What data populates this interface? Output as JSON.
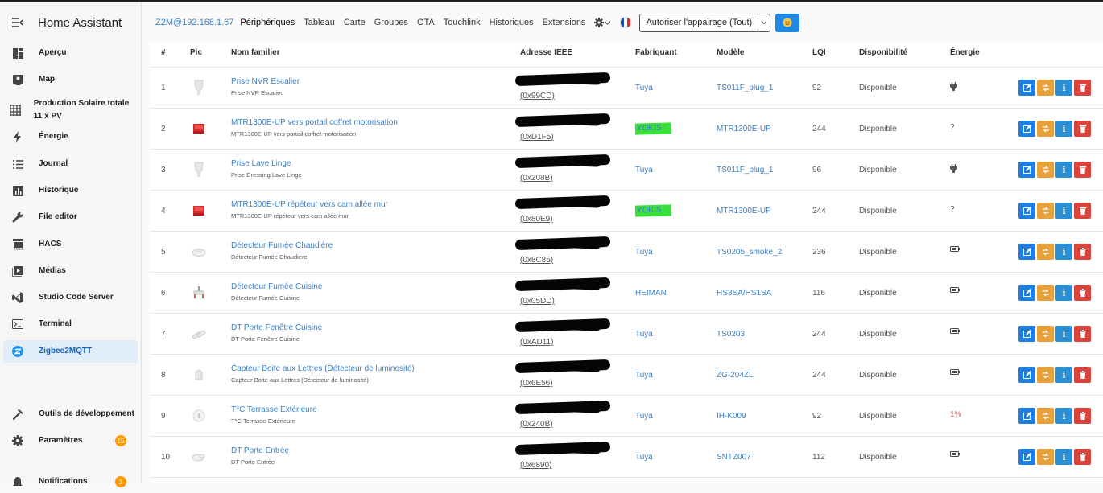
{
  "sidebar": {
    "title": "Home Assistant",
    "items": [
      {
        "label": "Aperçu",
        "icon": "dashboard-icon"
      },
      {
        "label": "Map",
        "icon": "map-icon"
      },
      {
        "label": "Production Solaire totale 11 x PV",
        "icon": "solar-grid-icon"
      },
      {
        "label": "Énergie",
        "icon": "lightning-icon"
      },
      {
        "label": "Journal",
        "icon": "list-icon"
      },
      {
        "label": "Historique",
        "icon": "chart-icon"
      },
      {
        "label": "File editor",
        "icon": "wrench-icon"
      },
      {
        "label": "HACS",
        "icon": "hacs-icon"
      },
      {
        "label": "Médias",
        "icon": "media-icon"
      },
      {
        "label": "Studio Code Server",
        "icon": "vscode-icon"
      },
      {
        "label": "Terminal",
        "icon": "terminal-icon"
      },
      {
        "label": "Zigbee2MQTT",
        "icon": "zigbee-icon"
      }
    ],
    "dev_tools": "Outils de développement",
    "settings": "Paramètres",
    "settings_badge": "15",
    "notifications": "Notifications",
    "notifications_badge": "3"
  },
  "nav": {
    "brand": "Z2M@192.168.1.67",
    "links": [
      "Périphériques",
      "Tableau",
      "Carte",
      "Groupes",
      "OTA",
      "Touchlink",
      "Historiques",
      "Extensions"
    ],
    "pairing_label": "Autoriser l'appairage (Tout)"
  },
  "table": {
    "headers": {
      "num": "#",
      "pic": "Pic",
      "name": "Nom familier",
      "ieee": "Adresse IEEE",
      "manufacturer": "Fabriquant",
      "model": "Modèle",
      "lqi": "LQI",
      "availability": "Disponibilité",
      "energy": "Énergie"
    },
    "rows": [
      {
        "num": "1",
        "name": "Prise NVR Escalier",
        "sub": "Prise NVR Escalier",
        "ieee": "(0x99CD)",
        "manufacturer": "Tuya",
        "model": "TS011F_plug_1",
        "lqi": "92",
        "availability": "Disponible",
        "energy": "plug",
        "pic": "plug"
      },
      {
        "num": "2",
        "name": "MTR1300E-UP vers portail coffret motorisation",
        "sub": "MTR1300E-UP vers portail coffret motorisation",
        "ieee": "(0xD1F5)",
        "manufacturer": "YOKIS",
        "model": "MTR1300E-UP",
        "lqi": "244",
        "availability": "Disponible",
        "energy": "?",
        "pic": "module"
      },
      {
        "num": "3",
        "name": "Prise Lave Linge",
        "sub": "Prise Dressing Lave Linge",
        "ieee": "(0x208B)",
        "manufacturer": "Tuya",
        "model": "TS011F_plug_1",
        "lqi": "96",
        "availability": "Disponible",
        "energy": "plug",
        "pic": "plug"
      },
      {
        "num": "4",
        "name": "MTR1300E-UP répéteur vers cam allée mur",
        "sub": "MTR1300E-UP répéteur vers cam allée mur",
        "ieee": "(0x80E9)",
        "manufacturer": "YOKIS",
        "model": "MTR1300E-UP",
        "lqi": "244",
        "availability": "Disponible",
        "energy": "?",
        "pic": "module"
      },
      {
        "num": "5",
        "name": "Détecteur Fumée Chaudière",
        "sub": "Détecteur Fumée Chaudière",
        "ieee": "(0x8C85)",
        "manufacturer": "Tuya",
        "model": "TS0205_smoke_2",
        "lqi": "236",
        "availability": "Disponible",
        "energy": "battery",
        "pic": "smoke"
      },
      {
        "num": "6",
        "name": "Détecteur Fumée Cuisine",
        "sub": "Détecteur Fumée Cuisine",
        "ieee": "(0x05DD)",
        "manufacturer": "HEIMAN",
        "model": "HS3SA/HS1SA",
        "lqi": "116",
        "availability": "Disponible",
        "energy": "battery",
        "pic": "smoke2"
      },
      {
        "num": "7",
        "name": "DT Porte Fenêtre Cuisine",
        "sub": "DT Porte Fenêtre Cuisine",
        "ieee": "(0xAD11)",
        "manufacturer": "Tuya",
        "model": "TS0203",
        "lqi": "244",
        "availability": "Disponible",
        "energy": "battery-full",
        "pic": "contact"
      },
      {
        "num": "8",
        "name": "Capteur Boite aux Lettres (Détecteur de luminosité)",
        "sub": "Capteur Boite aux Lettres (Détecteur de luminosité)",
        "ieee": "(0x6E56)",
        "manufacturer": "Tuya",
        "model": "ZG-204ZL",
        "lqi": "244",
        "availability": "Disponible",
        "energy": "battery-full",
        "pic": "sensor"
      },
      {
        "num": "9",
        "name": "T°C Terrasse Extérieure",
        "sub": "T°C Terrasse Extérieure",
        "ieee": "(0x240B)",
        "manufacturer": "Tuya",
        "model": "IH-K009",
        "lqi": "92",
        "availability": "Disponible",
        "energy": "1%",
        "pic": "round"
      },
      {
        "num": "10",
        "name": "DT Porte Entrée",
        "sub": "DT Porte Entrée",
        "ieee": "(0x6890)",
        "manufacturer": "Tuya",
        "model": "SNTZ007",
        "lqi": "112",
        "availability": "Disponible",
        "energy": "battery",
        "pic": "contact2"
      }
    ]
  },
  "colors": {
    "accent": "#3b7fc4",
    "highlight": "#39e03a",
    "edit": "#1e7fe0",
    "rename": "#e7a13b",
    "delete": "#d9453c",
    "badge": "#ff9800"
  }
}
